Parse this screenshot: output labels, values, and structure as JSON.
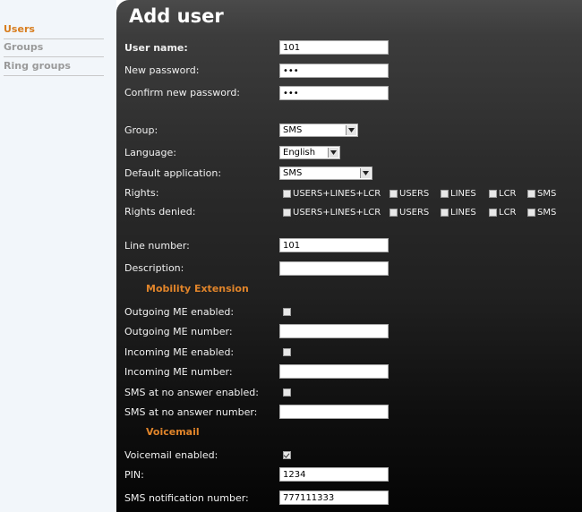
{
  "sidebar": {
    "items": [
      {
        "label": "Users"
      },
      {
        "label": "Groups"
      },
      {
        "label": "Ring groups"
      }
    ]
  },
  "page_title": "Add user",
  "fields": {
    "user_name": {
      "label": "User name:",
      "value": "101"
    },
    "new_password": {
      "label": "New password:",
      "value": "•••"
    },
    "confirm_password": {
      "label": "Confirm new password:",
      "value": "•••"
    },
    "group": {
      "label": "Group:",
      "value": "SMS"
    },
    "language": {
      "label": "Language:",
      "value": "English"
    },
    "default_app": {
      "label": "Default application:",
      "value": "SMS"
    },
    "rights": {
      "label": "Rights:"
    },
    "rights_denied": {
      "label": "Rights denied:"
    },
    "rights_options": [
      "USERS+LINES+LCR",
      "USERS",
      "LINES",
      "LCR",
      "SMS"
    ],
    "line_number": {
      "label": "Line number:",
      "value": "101"
    },
    "description": {
      "label": "Description:",
      "value": ""
    }
  },
  "mobility": {
    "title": "Mobility Extension",
    "outgoing_enabled": {
      "label": "Outgoing ME enabled:",
      "checked": false
    },
    "outgoing_number": {
      "label": "Outgoing ME number:",
      "value": ""
    },
    "incoming_enabled": {
      "label": "Incoming ME enabled:",
      "checked": false
    },
    "incoming_number": {
      "label": "Incoming ME number:",
      "value": ""
    },
    "sms_no_answer_enabled": {
      "label": "SMS at no answer enabled:",
      "checked": false
    },
    "sms_no_answer_number": {
      "label": "SMS at no answer number:",
      "value": ""
    }
  },
  "voicemail": {
    "title": "Voicemail",
    "enabled": {
      "label": "Voicemail enabled:",
      "checked": true
    },
    "pin": {
      "label": "PIN:",
      "value": "1234"
    },
    "sms_notification": {
      "label": "SMS notification number:",
      "value": "777111333"
    }
  },
  "colors": {
    "accent": "#d87d1e",
    "section": "#e0842a",
    "panel_top": "#4a4a4a",
    "panel_bottom": "#050505"
  }
}
